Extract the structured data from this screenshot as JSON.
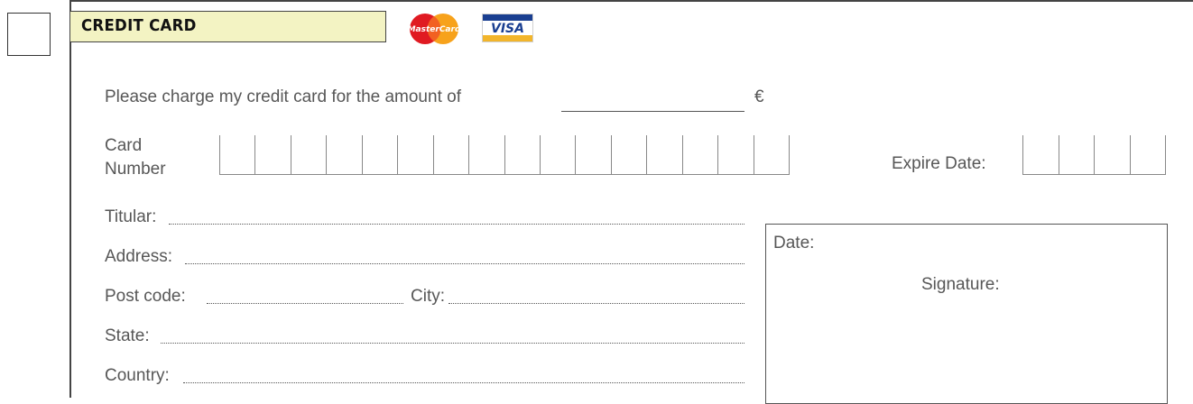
{
  "header": {
    "title": "CREDIT CARD"
  },
  "logos": {
    "mastercard_text": "MasterCard",
    "visa_text": "VISA"
  },
  "amount": {
    "prefix": "Please charge my credit card for the amount of",
    "currency": "€"
  },
  "card_number": {
    "label_line1": "Card",
    "label_line2": "Number",
    "digit_count": 16
  },
  "expire": {
    "label": "Expire Date:",
    "digit_count": 4
  },
  "fields": {
    "titular": "Titular:",
    "address": "Address:",
    "post_code": "Post code:",
    "city": "City:",
    "state": "State:",
    "country": "Country:"
  },
  "signature_box": {
    "date_label": "Date:",
    "signature_label": "Signature:"
  },
  "colors": {
    "header_band": "#f3f3c3",
    "mastercard_red": "#e01a22",
    "mastercard_orange": "#f7a21b",
    "visa_blue": "#1a3f91",
    "visa_gold": "#f2b52b"
  },
  "icons": [
    "checkbox",
    "mastercard-logo",
    "visa-logo"
  ]
}
